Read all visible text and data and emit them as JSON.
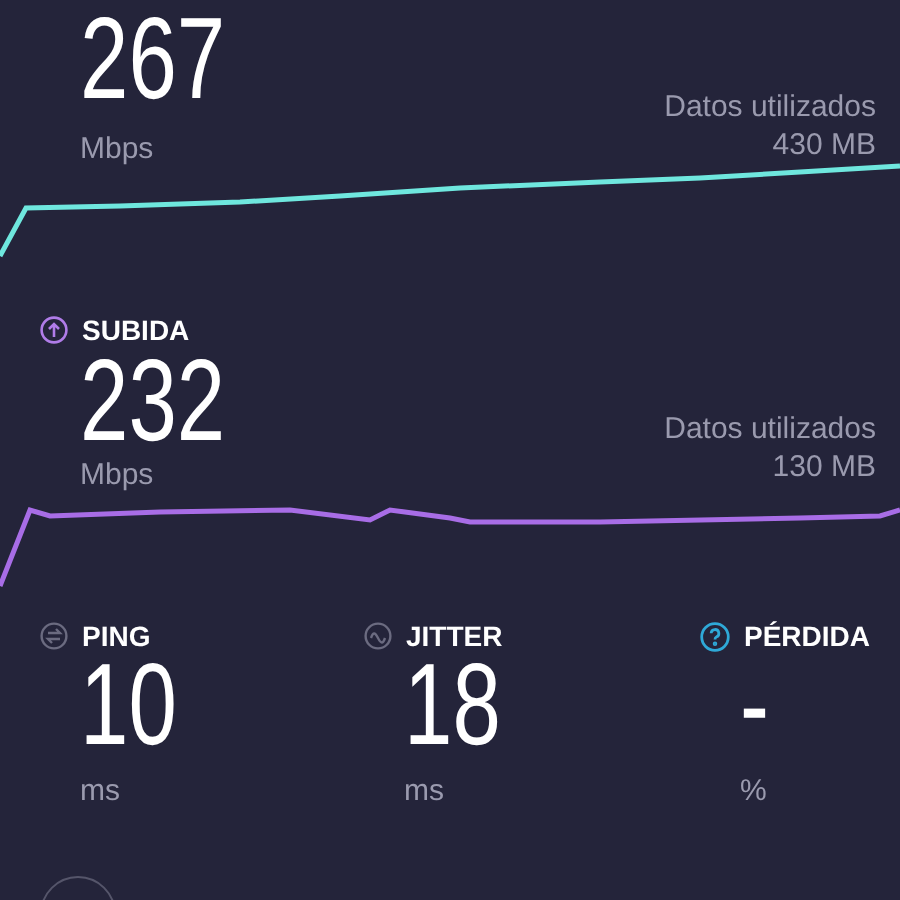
{
  "download": {
    "value": "267",
    "unit": "Mbps",
    "data_label": "Datos utilizados",
    "data_amount": "430 MB"
  },
  "upload": {
    "label": "SUBIDA",
    "value": "232",
    "unit": "Mbps",
    "data_label": "Datos utilizados",
    "data_amount": "130 MB"
  },
  "stats": [
    {
      "kind": "ping",
      "label": "PING",
      "value": "10",
      "unit": "ms"
    },
    {
      "kind": "jitter",
      "label": "JITTER",
      "value": "18",
      "unit": "ms"
    },
    {
      "kind": "loss",
      "label": "PÉRDIDA",
      "value": "-",
      "unit": "%"
    }
  ]
}
